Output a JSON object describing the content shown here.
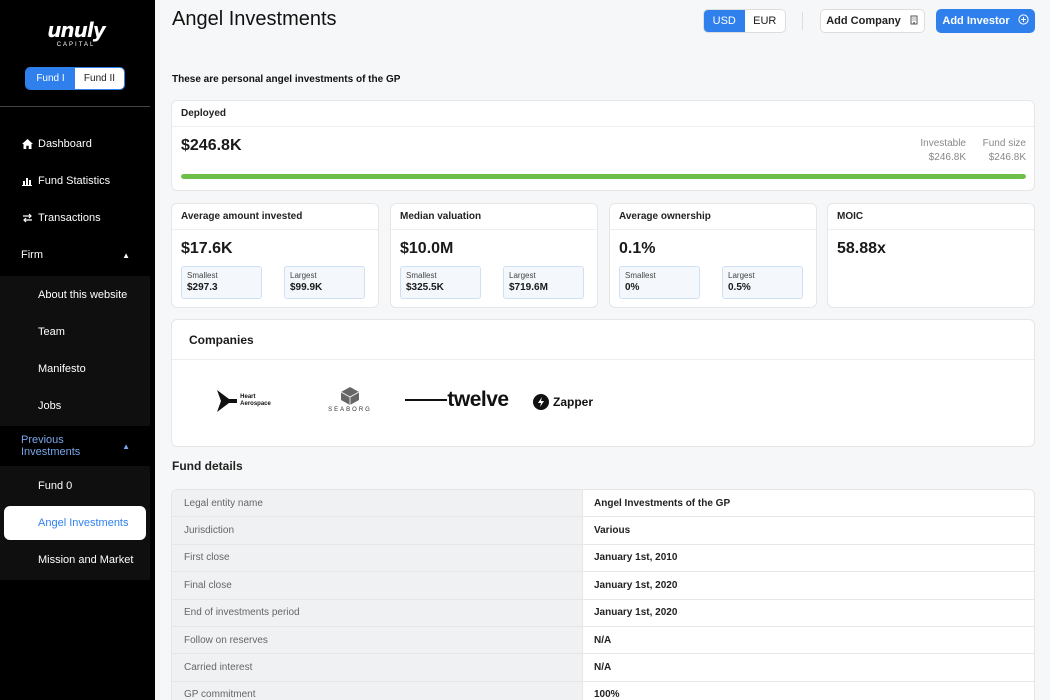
{
  "brand": {
    "logo_word": "unuly",
    "logo_sub": "CAPITAL"
  },
  "fund_switch": {
    "options": [
      "Fund I",
      "Fund II"
    ],
    "selected": "Fund I"
  },
  "sidebar": {
    "nav": [
      {
        "label": "Dashboard",
        "icon": "home-icon"
      },
      {
        "label": "Fund Statistics",
        "icon": "chart-icon"
      },
      {
        "label": "Transactions",
        "icon": "swap-icon"
      }
    ],
    "firm": {
      "label": "Firm",
      "items": [
        "About this website",
        "Team",
        "Manifesto",
        "Jobs"
      ]
    },
    "previous": {
      "label": "Previous Investments",
      "items": [
        "Fund 0",
        "Angel Investments",
        "Mission and Market"
      ],
      "active": "Angel Investments"
    }
  },
  "header": {
    "title": "Angel Investments",
    "currency": {
      "options": [
        "USD",
        "EUR"
      ],
      "selected": "USD"
    },
    "add_company": "Add Company",
    "add_investor": "Add Investor"
  },
  "subtitle": "These are personal angel investments of the GP",
  "deployed": {
    "label": "Deployed",
    "value": "$246.8K",
    "investable_label": "Investable",
    "investable_value": "$246.8K",
    "fund_size_label": "Fund size",
    "fund_size_value": "$246.8K",
    "progress_pct": 100,
    "progress_color": "#6cc04a"
  },
  "metrics": {
    "avg_invested": {
      "label": "Average amount invested",
      "value": "$17.6K",
      "smallest_label": "Smallest",
      "smallest": "$297.3",
      "largest_label": "Largest",
      "largest": "$99.9K"
    },
    "median_valuation": {
      "label": "Median valuation",
      "value": "$10.0M",
      "smallest_label": "Smallest",
      "smallest": "$325.5K",
      "largest_label": "Largest",
      "largest": "$719.6M"
    },
    "avg_ownership": {
      "label": "Average ownership",
      "value": "0.1%",
      "smallest_label": "Smallest",
      "smallest": "0%",
      "largest_label": "Largest",
      "largest": "0.5%"
    },
    "moic": {
      "label": "MOIC",
      "value": "58.88x"
    }
  },
  "companies": {
    "label": "Companies",
    "logos": [
      {
        "name": "Heart Aerospace",
        "line1": "Heart",
        "line2": "Aerospace"
      },
      {
        "name": "SEABORG",
        "text": "SEABORG"
      },
      {
        "name": "twelve",
        "text": "twelve"
      },
      {
        "name": "Zapper",
        "text": "Zapper"
      }
    ]
  },
  "fund_details": {
    "label": "Fund details",
    "rows": [
      {
        "key": "Legal entity name",
        "value": "Angel Investments of the GP"
      },
      {
        "key": "Jurisdiction",
        "value": "Various"
      },
      {
        "key": "First close",
        "value": "January 1st, 2010"
      },
      {
        "key": "Final close",
        "value": "January 1st, 2020"
      },
      {
        "key": "End of investments period",
        "value": "January 1st, 2020"
      },
      {
        "key": "Follow on reserves",
        "value": "N/A"
      },
      {
        "key": "Carried interest",
        "value": "N/A"
      },
      {
        "key": "GP commitment",
        "value": "100%"
      }
    ]
  },
  "colors": {
    "accent": "#2f80ed",
    "sidebar_bg": "#000000",
    "progress": "#6cc04a"
  }
}
